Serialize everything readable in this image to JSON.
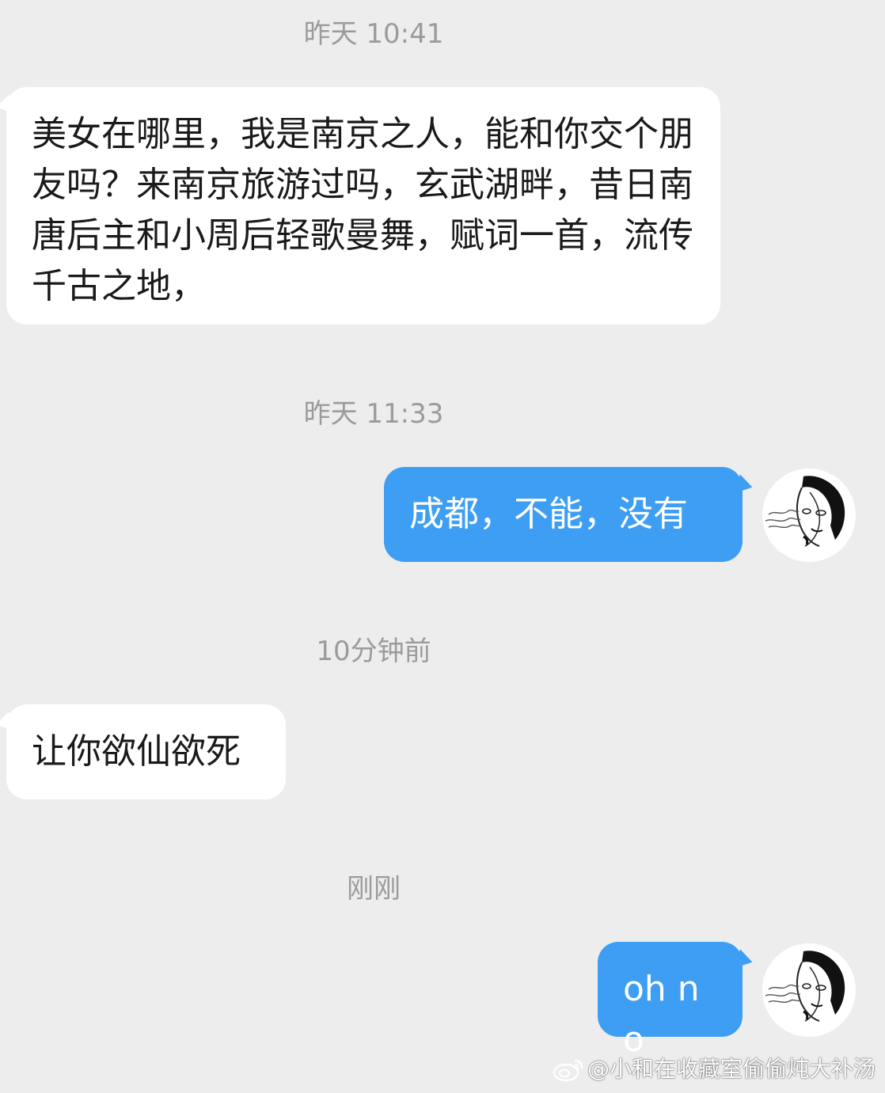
{
  "chat": {
    "messages": [
      {
        "time": "昨天 10:41",
        "direction": "incoming",
        "text": "美女在哪里，我是南京之人，能和你交个朋友吗？来南京旅游过吗，玄武湖畔，昔日南唐后主和小周后轻歌曼舞，赋词一首，流传千古之地，"
      },
      {
        "time": "昨天 11:33",
        "direction": "outgoing",
        "text": "成都，不能，没有"
      },
      {
        "time": "10分钟前",
        "direction": "incoming",
        "text": "让你欲仙欲死"
      },
      {
        "time": "刚刚",
        "direction": "outgoing",
        "text": "oh no"
      }
    ]
  },
  "watermark": {
    "text": "@小和在收藏室偷偷炖大补汤",
    "icon": "weibo-icon"
  },
  "colors": {
    "background": "#ededed",
    "incoming_bubble": "#ffffff",
    "outgoing_bubble": "#3d9ef4",
    "timestamp": "#9b9b9b"
  },
  "avatar": {
    "icon": "user-avatar-illustration"
  }
}
